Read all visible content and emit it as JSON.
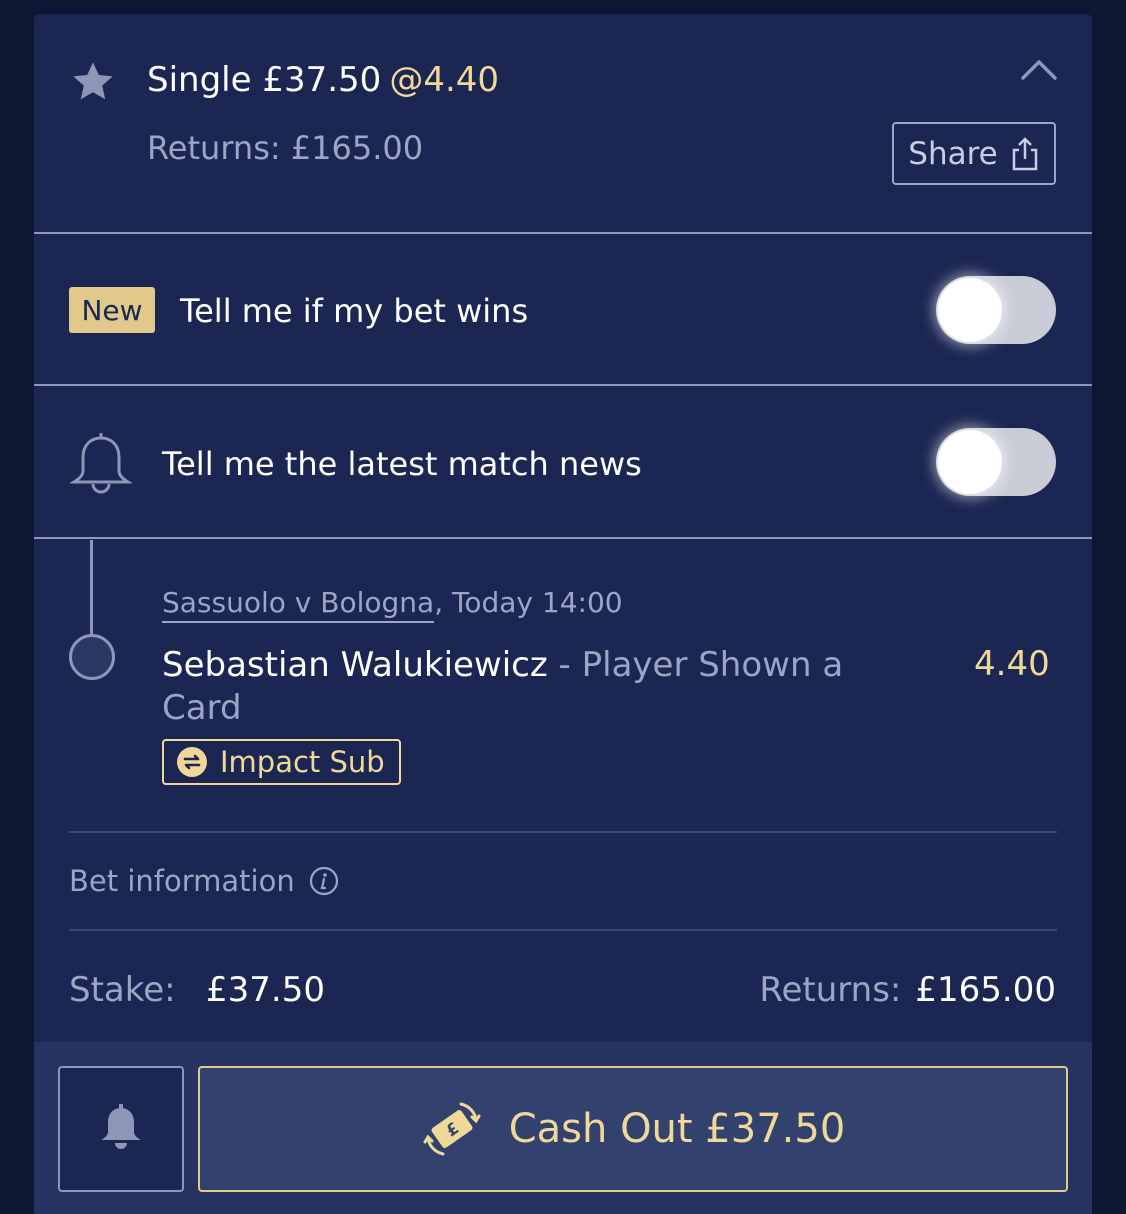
{
  "header": {
    "title": "Single £37.50",
    "odds": "@4.40",
    "returns": "Returns: £165.00",
    "share_label": "Share",
    "star_icon": "star-icon",
    "collapse_icon": "chevron-up-icon"
  },
  "notifications": {
    "new_badge": "New",
    "bet_wins_label": "Tell me if my bet wins",
    "bet_wins_on": false,
    "match_news_label": "Tell me the latest match news",
    "match_news_on": false
  },
  "selection": {
    "event": "Sassuolo v Bologna",
    "event_time": ", Today 14:00",
    "player": "Sebastian Walukiewicz",
    "market": " - Player Shown a Card",
    "odds": "4.40",
    "badge": "Impact Sub"
  },
  "bet_info": {
    "label": "Bet information"
  },
  "summary": {
    "stake_label": "Stake:",
    "stake_value": "£37.50",
    "returns_label": "Returns:",
    "returns_value": "£165.00"
  },
  "footer": {
    "cashout_label": "Cash Out £37.50"
  },
  "colors": {
    "background": "#0d1733",
    "card": "#1b2652",
    "accent_gold": "#f0d898",
    "muted_text": "#9aa6c4"
  }
}
